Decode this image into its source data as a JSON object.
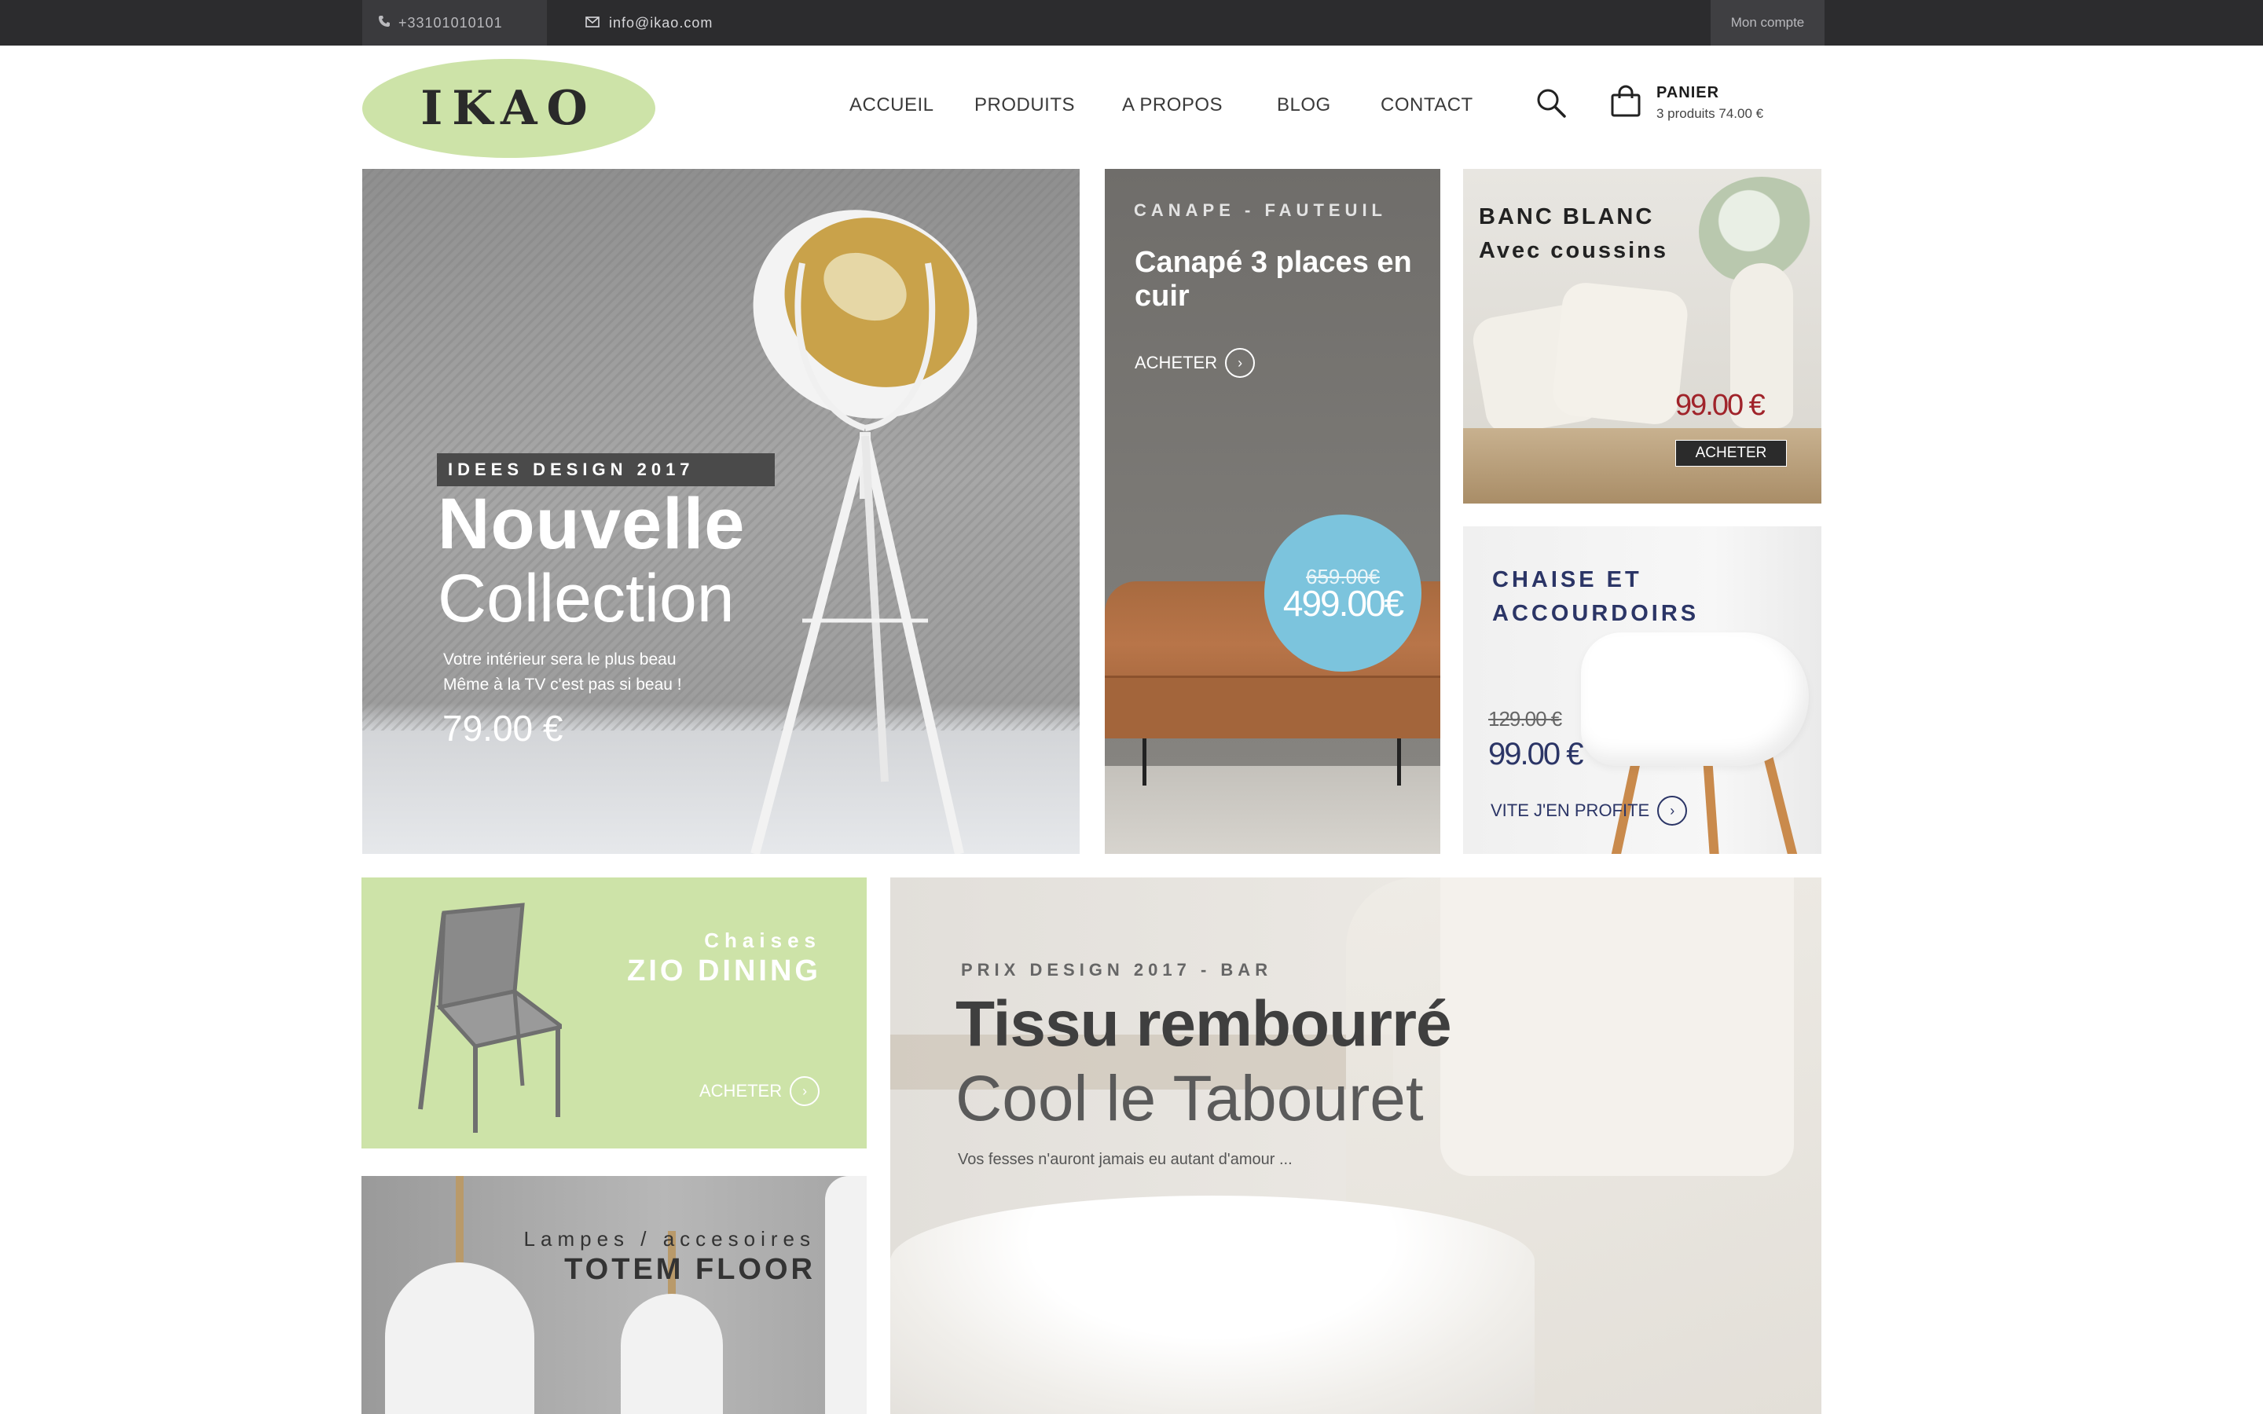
{
  "topbar": {
    "phone": "+33101010101",
    "phone_icon": "phone-icon",
    "email": "info@ikao.com",
    "email_icon": "envelope-icon",
    "account": "Mon compte"
  },
  "header": {
    "logo": "IKAO",
    "nav": [
      "ACCUEIL",
      "PRODUITS",
      "A PROPOS",
      "BLOG",
      "CONTACT"
    ],
    "search_icon": "search-icon",
    "cart_icon": "shopping-bag-icon",
    "cart_title": "PANIER",
    "cart_sub": "3 produits 74.00 €"
  },
  "hero": {
    "tag": "IDEES DESIGN 2017",
    "title1": "Nouvelle",
    "title2": "Collection",
    "line1": "Votre intérieur sera le plus beau",
    "line2": "Même à la TV c'est pas si beau !",
    "price": "79.00 €"
  },
  "sofa": {
    "category": "CANAPE - FAUTEUIL",
    "title": "Canapé 3 places en cuir",
    "cta": "ACHETER",
    "old_price": "659.00€",
    "new_price": "499.00€"
  },
  "banc": {
    "title1": "BANC BLANC",
    "title2": "Avec coussins",
    "price": "99.00 €",
    "cta": "ACHETER"
  },
  "chaise": {
    "title1": "CHAISE ET",
    "title2": "ACCOURDOIRS",
    "old_price": "129.00 €",
    "new_price": "99.00 €",
    "cta": "VITE J'EN PROFITE"
  },
  "zio": {
    "category": "Chaises",
    "title": "ZIO DINING",
    "cta": "ACHETER"
  },
  "totem": {
    "category": "Lampes / accesoires",
    "title": "TOTEM FLOOR"
  },
  "bar": {
    "category": "PRIX DESIGN 2017 - BAR",
    "title1": "Tissu rembourré",
    "title2": "Cool le Tabouret",
    "text": "Vos fesses n'auront jamais eu autant d'amour ..."
  },
  "colors": {
    "topbar": "#2c2c2e",
    "accent_green": "#cde3a8",
    "sale_blue": "#7cc4dd",
    "price_red": "#a0232a",
    "navy": "#2b3566"
  }
}
